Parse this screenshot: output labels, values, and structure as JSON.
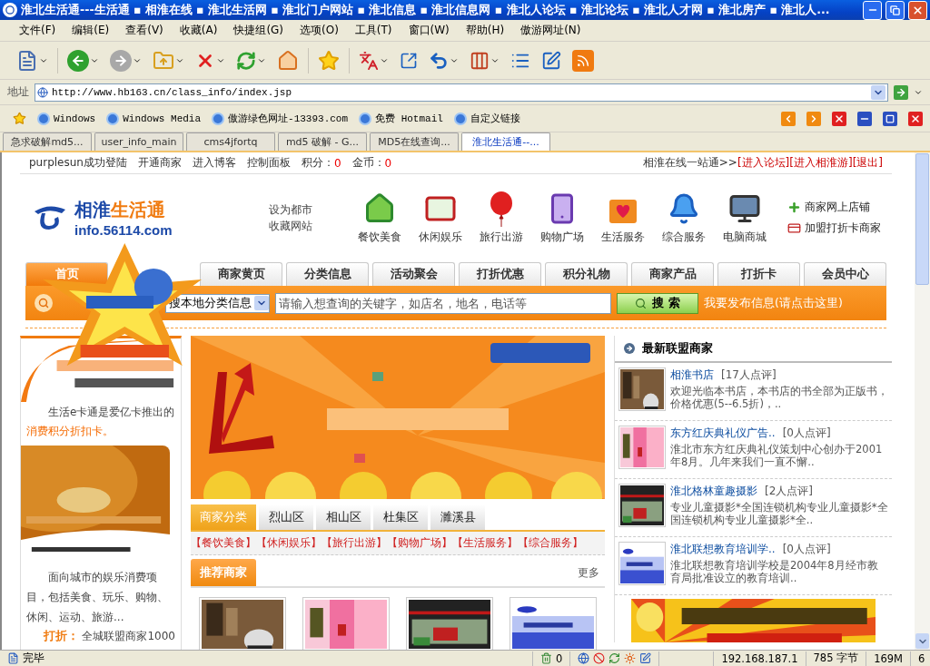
{
  "window": {
    "title": "淮北生活通---生活通 ▪ 相淮在线 ▪ 淮北生活网 ▪ 淮北门户网站 ▪ 淮北信息 ▪ 淮北信息网 ▪ 淮北人论坛 ▪ 淮北论坛 ▪ 淮北人才网 ▪ 淮北房产 ▪ 淮北人..."
  },
  "menu": [
    "文件(F)",
    "编辑(E)",
    "查看(V)",
    "收藏(A)",
    "快捷组(G)",
    "选项(O)",
    "工具(T)",
    "窗口(W)",
    "帮助(H)",
    "傲游网址(N)"
  ],
  "address": {
    "label": "地址",
    "url": "http://www.hb163.cn/class_info/index.jsp"
  },
  "links": [
    "Windows",
    "Windows Media",
    "傲游绿色网址-13393.com",
    "免费 Hotmail",
    "自定义链接"
  ],
  "browser_tabs": [
    {
      "label": "急求破解md5...",
      "selected": false
    },
    {
      "label": "user_info_main",
      "selected": false
    },
    {
      "label": "cms4jfortq",
      "selected": false
    },
    {
      "label": "md5 破解 - G...",
      "selected": false
    },
    {
      "label": "MD5在线查询...",
      "selected": false
    },
    {
      "label": "淮北生活通--...",
      "selected": true
    }
  ],
  "top_bar": {
    "user": "purplesun成功登陆",
    "links": [
      "开通商家",
      "进入博客",
      "控制面板"
    ],
    "points_label": "积分：",
    "points": "0",
    "coins_label": "金币：",
    "coins": "0",
    "portal": "相淮在线一站通>>",
    "portal_links": [
      "[进入论坛]",
      "[进入相淮游]",
      "[退出]"
    ]
  },
  "logo": {
    "name_a": "相淮",
    "name_b": "生活通",
    "domain": "info.56114.com"
  },
  "favorite": "设为都市收藏网站",
  "categories": [
    {
      "kind": "house",
      "label": "餐饮美食"
    },
    {
      "kind": "envelope",
      "label": "休闲娱乐"
    },
    {
      "kind": "balloon",
      "label": "旅行出游"
    },
    {
      "kind": "phone",
      "label": "购物广场"
    },
    {
      "kind": "heart",
      "label": "生活服务"
    },
    {
      "kind": "bell",
      "label": "综合服务"
    },
    {
      "kind": "computer",
      "label": "电脑商城"
    }
  ],
  "merchant_links": [
    {
      "kind": "plus",
      "label": "商家网上店铺"
    },
    {
      "kind": "card",
      "label": "加盟打折卡商家"
    }
  ],
  "nav": [
    {
      "label": "首页",
      "selected": true
    },
    {
      "label": "商家黄页",
      "selected": false
    },
    {
      "label": "分类信息",
      "selected": false
    },
    {
      "label": "活动聚会",
      "selected": false
    },
    {
      "label": "打折优惠",
      "selected": false
    },
    {
      "label": "积分礼物",
      "selected": false
    },
    {
      "label": "商家产品",
      "selected": false
    },
    {
      "label": "打折卡",
      "selected": false
    },
    {
      "label": "会员中心",
      "selected": false
    }
  ],
  "search": {
    "scope": "搜本地分类信息",
    "placeholder": "请输入想查询的关键字，如店名，地名，电话等",
    "button": "搜 索",
    "post_link": "我要发布信息(请点击这里)"
  },
  "left": {
    "intro": "生活e卡通是爱亿卡推出的",
    "intro_highlight": "消费积分折扣卡。",
    "body": "面向城市的娱乐消费项目，包括美食、玩乐、购物、休闲、运动、旅游...",
    "discount": "**打折：** 全城联盟商家1000"
  },
  "districts": [
    {
      "label": "商家分类",
      "selected": true
    },
    {
      "label": "烈山区",
      "selected": false
    },
    {
      "label": "相山区",
      "selected": false
    },
    {
      "label": "杜集区",
      "selected": false
    },
    {
      "label": "濉溪县",
      "selected": false
    }
  ],
  "category_links": [
    "【餐饮美食】",
    "【休闲娱乐】",
    "【旅行出游】",
    "【购物广场】",
    "【生活服务】",
    "【综合服务】"
  ],
  "recommended": {
    "title": "推荐商家",
    "more": "更多"
  },
  "latest": {
    "title": "最新联盟商家",
    "items": [
      {
        "name": "相淮书店",
        "reviews": "[17人点评]",
        "desc": "欢迎光临本书店，本书店的书全部为正版书，价格优惠(5--6.5折)，.."
      },
      {
        "name": "东方红庆典礼仪广告..",
        "reviews": "[0人点评]",
        "desc": "淮北市东方红庆典礼仪策划中心创办于2001年8月。几年来我们一直不懈.."
      },
      {
        "name": "淮北格林童趣摄影",
        "reviews": "[2人点评]",
        "desc": "专业儿童摄影*全国连锁机构专业儿童摄影*全国连锁机构专业儿童摄影*全.."
      },
      {
        "name": "淮北联想教育培训学..",
        "reviews": "[0人点评]",
        "desc": "淮北联想教育培训学校是2004年8月经市教育局批准设立的教育培训.."
      }
    ]
  },
  "status": {
    "text": "完毕",
    "count": "0",
    "ip": "192.168.187.1",
    "size": "785 字节",
    "memory": "169M",
    "number": "6"
  }
}
